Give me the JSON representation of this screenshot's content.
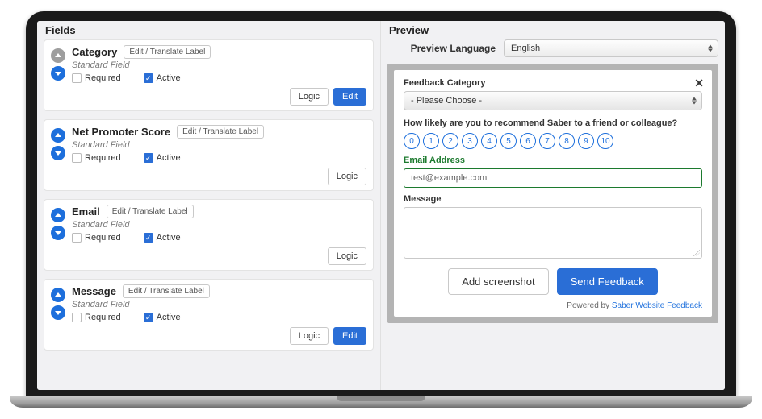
{
  "left": {
    "title": "Fields",
    "pill_label": "Edit / Translate Label",
    "standard_label": "Standard Field",
    "required_label": "Required",
    "active_label": "Active",
    "logic_label": "Logic",
    "edit_label": "Edit",
    "fields": [
      {
        "name": "Category",
        "up_enabled": false,
        "show_edit": true
      },
      {
        "name": "Net Promoter Score",
        "up_enabled": true,
        "show_edit": false
      },
      {
        "name": "Email",
        "up_enabled": true,
        "show_edit": false
      },
      {
        "name": "Message",
        "up_enabled": true,
        "show_edit": true
      }
    ]
  },
  "right": {
    "title": "Preview",
    "lang_label": "Preview Language",
    "lang_value": "English",
    "category_label": "Feedback Category",
    "category_value": "- Please Choose -",
    "nps_question": "How likely are you to recommend Saber to a friend or colleague?",
    "nps_values": [
      "0",
      "1",
      "2",
      "3",
      "4",
      "5",
      "6",
      "7",
      "8",
      "9",
      "10"
    ],
    "email_label": "Email Address",
    "email_value": "test@example.com",
    "message_label": "Message",
    "add_screenshot": "Add screenshot",
    "send_feedback": "Send Feedback",
    "powered_prefix": "Powered by ",
    "powered_link": "Saber Website Feedback"
  }
}
